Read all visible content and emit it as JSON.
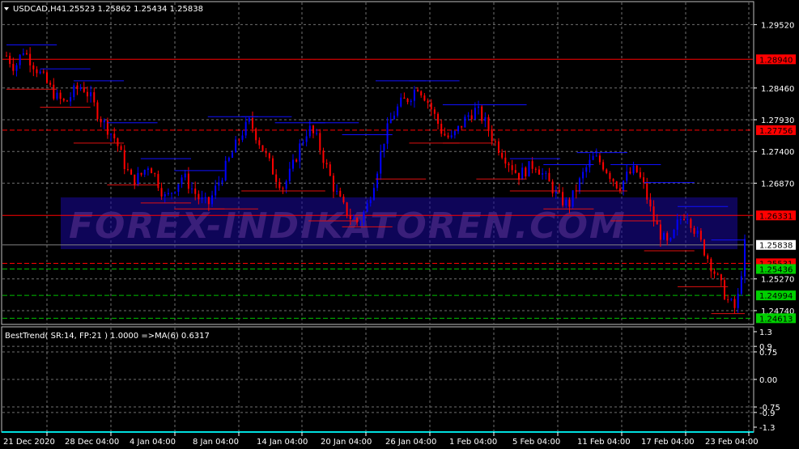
{
  "header": {
    "symbol": "USDCAD,H4",
    "ohlc": "1.25523 1.25862 1.25434 1.25838",
    "menu_icon": "triangle-down-icon"
  },
  "watermark": "FOREX-INDIKATOREN.COM",
  "colors": {
    "background": "#000000",
    "bull_candle": "#0000ff",
    "bear_candle": "#ff0000",
    "resistance": "#ff0000",
    "support": "#00c000",
    "watermark_band": "#1a0aa0",
    "price_tag": "#ffffff"
  },
  "price_axis": {
    "ticks": [
      {
        "label": "1.29520",
        "value": 1.2952
      },
      {
        "label": "1.28460",
        "value": 1.2846
      },
      {
        "label": "1.27930",
        "value": 1.2793
      },
      {
        "label": "1.27400",
        "value": 1.274
      },
      {
        "label": "1.26870",
        "value": 1.2687
      },
      {
        "label": "1.25270",
        "value": 1.2527
      },
      {
        "label": "1.24740",
        "value": 1.2474
      }
    ],
    "tags": [
      {
        "label": "1.28940",
        "value": 1.2894,
        "type": "red"
      },
      {
        "label": "1.27756",
        "value": 1.27756,
        "type": "red"
      },
      {
        "label": "1.26331",
        "value": 1.26331,
        "type": "red"
      },
      {
        "label": "1.25838",
        "value": 1.25838,
        "type": "price"
      },
      {
        "label": "1.25531",
        "value": 1.25531,
        "type": "red"
      },
      {
        "label": "1.25436",
        "value": 1.25436,
        "type": "green"
      },
      {
        "label": "1.24994",
        "value": 1.24994,
        "type": "green"
      },
      {
        "label": "1.24613",
        "value": 1.24613,
        "type": "green"
      }
    ]
  },
  "indicator": {
    "label": "BestTrend( SR:14, FP:21 ) 1.0000  =>MA(6) 0.6317",
    "ticks": [
      {
        "label": "1.3",
        "value": 1.3
      },
      {
        "label": "0.9",
        "value": 0.9
      },
      {
        "label": "0.75",
        "value": 0.75
      },
      {
        "label": "0.00",
        "value": 0.0
      },
      {
        "label": "-0.75",
        "value": -0.75
      },
      {
        "label": "-0.9",
        "value": -0.9
      },
      {
        "label": "-1.3",
        "value": -1.3
      }
    ]
  },
  "time_axis": {
    "labels": [
      "21 Dec 2020",
      "28 Dec 04:00",
      "4 Jan 04:00",
      "8 Jan 04:00",
      "14 Jan 04:00",
      "20 Jan 04:00",
      "26 Jan 04:00",
      "1 Feb 04:00",
      "5 Feb 04:00",
      "11 Feb 04:00",
      "17 Feb 04:00",
      "23 Feb 04:00"
    ]
  },
  "chart_data": {
    "type": "candlestick",
    "ylim": [
      1.2455,
      1.2985
    ],
    "grid": true,
    "close_path": [
      1.29,
      1.288,
      1.291,
      1.289,
      1.287,
      1.285,
      1.283,
      1.282,
      1.284,
      1.285,
      1.283,
      1.28,
      1.278,
      1.276,
      1.272,
      1.269,
      1.27,
      1.272,
      1.269,
      1.266,
      1.268,
      1.27,
      1.268,
      1.266,
      1.265,
      1.268,
      1.271,
      1.274,
      1.277,
      1.279,
      1.276,
      1.273,
      1.27,
      1.268,
      1.271,
      1.275,
      1.278,
      1.276,
      1.272,
      1.268,
      1.265,
      1.263,
      1.262,
      1.265,
      1.27,
      1.276,
      1.28,
      1.282,
      1.283,
      1.285,
      1.283,
      1.28,
      1.277,
      1.276,
      1.278,
      1.28,
      1.281,
      1.279,
      1.276,
      1.274,
      1.272,
      1.27,
      1.271,
      1.272,
      1.27,
      1.268,
      1.266,
      1.265,
      1.268,
      1.271,
      1.273,
      1.272,
      1.27,
      1.268,
      1.27,
      1.271,
      1.268,
      1.263,
      1.26,
      1.258,
      1.262,
      1.264,
      1.261,
      1.258,
      1.255,
      1.252,
      1.249,
      1.2475,
      1.2584
    ]
  }
}
